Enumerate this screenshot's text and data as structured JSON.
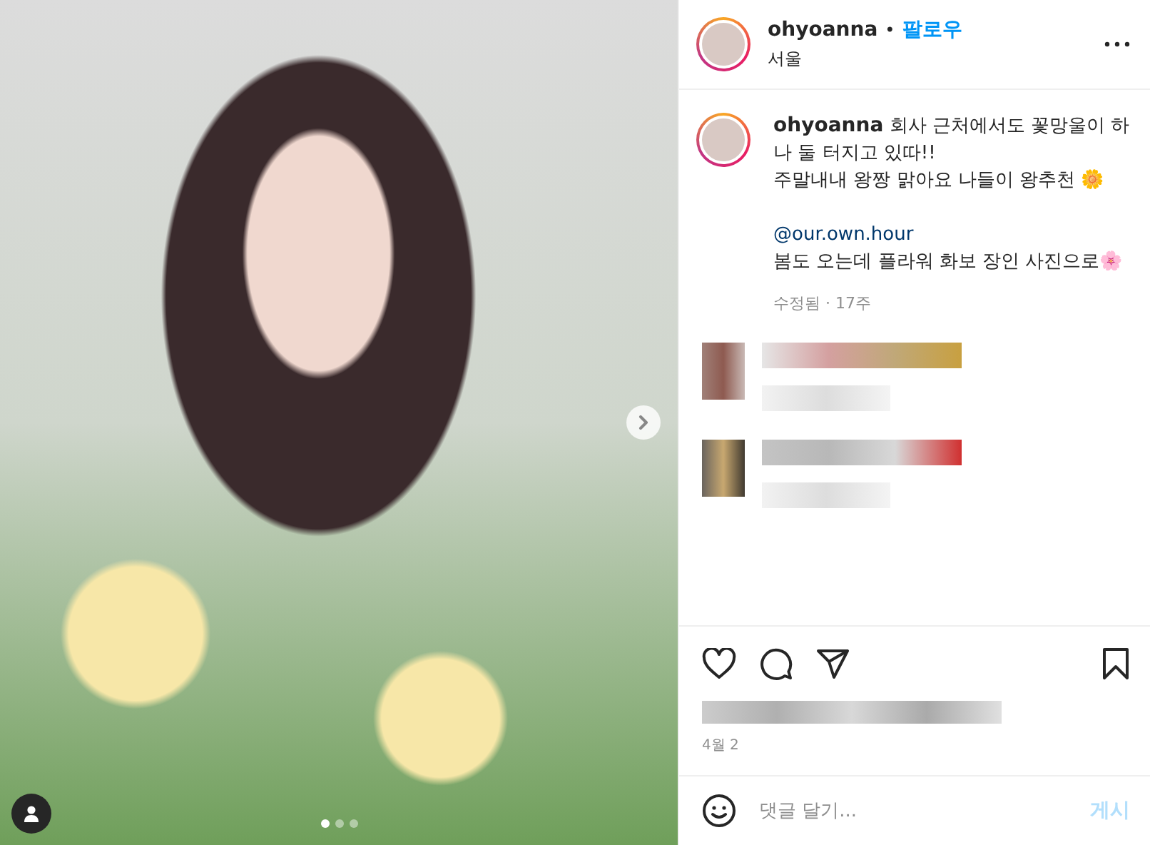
{
  "post": {
    "image_count_dots": [
      {
        "selected": true
      },
      {
        "selected": false
      },
      {
        "selected": false
      }
    ]
  },
  "header": {
    "username": "ohyoanna",
    "separator": "•",
    "follow": "팔로우",
    "location": "서울"
  },
  "caption": {
    "username": "ohyoanna",
    "lines": [
      {
        "kind": "text",
        "text": "회사 근처에서도 꽃망울이 하나 둘 터지고 있따!!"
      },
      {
        "kind": "text",
        "text": "주말내내 왕짱 맑아요 나들이 왕추천 🌼"
      },
      {
        "kind": "blank"
      },
      {
        "kind": "mention",
        "text": "@our.own.hour"
      },
      {
        "kind": "text",
        "text": "봄도 오는데 플라워 화보 장인 사진으로🌸"
      }
    ],
    "meta": "수정됨 · 17주"
  },
  "date": "4월 2",
  "comment_box": {
    "placeholder": "댓글 달기...",
    "post_button": "게시",
    "disabled": true
  }
}
